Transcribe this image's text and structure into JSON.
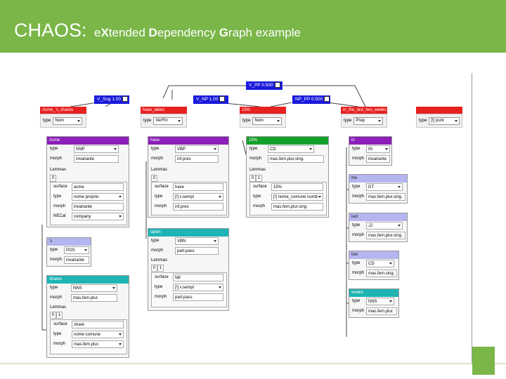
{
  "title": {
    "main": "CHAOS:",
    "sub_pre": "e",
    "sub_x": "X",
    "sub_mid1": "tended ",
    "sub_d": "D",
    "sub_mid2": "ependency ",
    "sub_g": "G",
    "sub_end": "raph  example"
  },
  "colors": {
    "title_bar": "#7ab648",
    "deprel": "#1a1adb",
    "node_head": "#e82020",
    "purple": "#8b1fb8",
    "green": "#14a02a",
    "teal": "#1fb3b3",
    "lavender": "#b5b5f0"
  },
  "deprels": [
    {
      "label": "V_PP 0.500"
    },
    {
      "label": "V_Sog 1.00"
    },
    {
      "label": "V_NP 1.00"
    },
    {
      "label": "NP_PP 0.500"
    }
  ],
  "nodes": [
    {
      "label": "Acme_'s_shares",
      "type": "Nom"
    },
    {
      "label": "have_taken",
      "type": "VerFin"
    },
    {
      "label": "15%",
      "type": "Nom"
    },
    {
      "label": "in_the_last_two_weeks",
      "type": "Prep"
    },
    {
      "label": "",
      "type": "[!] punt"
    }
  ],
  "panels": {
    "acme": {
      "title": "Acme",
      "type": "NNP",
      "morph": "invariante",
      "surface": "acme",
      "ltype": "nome proprio",
      "lmorph": "invariante",
      "necat_label": "NECat",
      "necat": "company"
    },
    "s": {
      "title": "'s",
      "type": "POS",
      "morph": "invariante"
    },
    "shares": {
      "title": "shares",
      "type": "NNS",
      "morph": "mas.fem.plur.",
      "surface": "share",
      "ltype": "nome comune",
      "lmorph": "mas.fem.plur."
    },
    "have": {
      "title": "have",
      "type": "VBP",
      "morph": "inf.pres",
      "surface": "have",
      "ltype": "[!] v.sempl",
      "lmorph": "inf.pres"
    },
    "taken": {
      "title": "taken",
      "type": "VBN",
      "morph": "part.pass",
      "surface": "fall",
      "ltype": "[!] v.sempl",
      "lmorph": "part.pass"
    },
    "pct": {
      "title": "15%",
      "type": "CD",
      "morph": "mas.fem.plur.sing.",
      "surface": "15%",
      "ltype": "[!] nome_comune numb",
      "lmorph": "mas.fem.plur.sing."
    },
    "in": {
      "title": "in",
      "type": "IN",
      "morph": "invariante"
    },
    "the": {
      "title": "the",
      "type": "DT",
      "morph": "mas.fem.plur.sing."
    },
    "last": {
      "title": "last",
      "type": "JJ",
      "morph": "mas.fem.plur.sing."
    },
    "two": {
      "title": "two",
      "type": "CD",
      "morph": "mas.fem.sing."
    },
    "weeks": {
      "title": "weeks",
      "type": "NNS",
      "morph": "mas.fem.plur."
    }
  },
  "labels": {
    "type": "type",
    "morph": "morph",
    "lemmas": "Lemmas",
    "surface": "surface",
    "tab0": "0",
    "tab1": "1"
  }
}
